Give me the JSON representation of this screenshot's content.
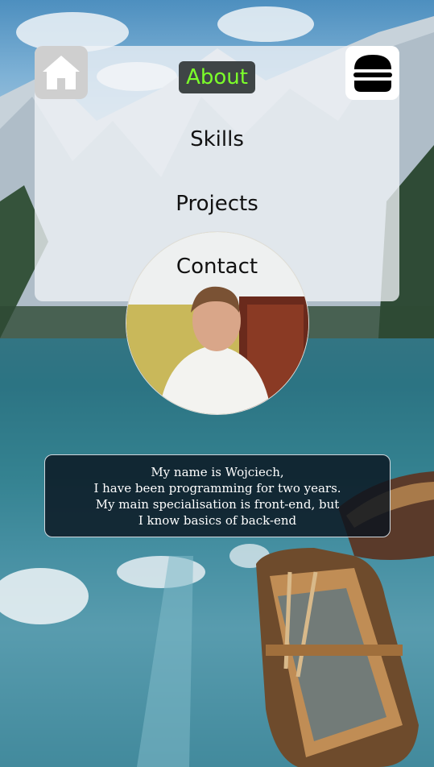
{
  "nav": {
    "home_icon": "home-icon",
    "menu_icon": "hamburger-icon",
    "items": [
      {
        "label": "About",
        "active": true
      },
      {
        "label": "Skills"
      },
      {
        "label": "Projects"
      },
      {
        "label": "Contact"
      }
    ],
    "active_color": "#7cff2a"
  },
  "profile": {
    "bio_lines": [
      "My name is Wojciech,",
      "I have been programming for two years.",
      "My main specialisation is front-end, but",
      "I know basics of back-end"
    ]
  }
}
